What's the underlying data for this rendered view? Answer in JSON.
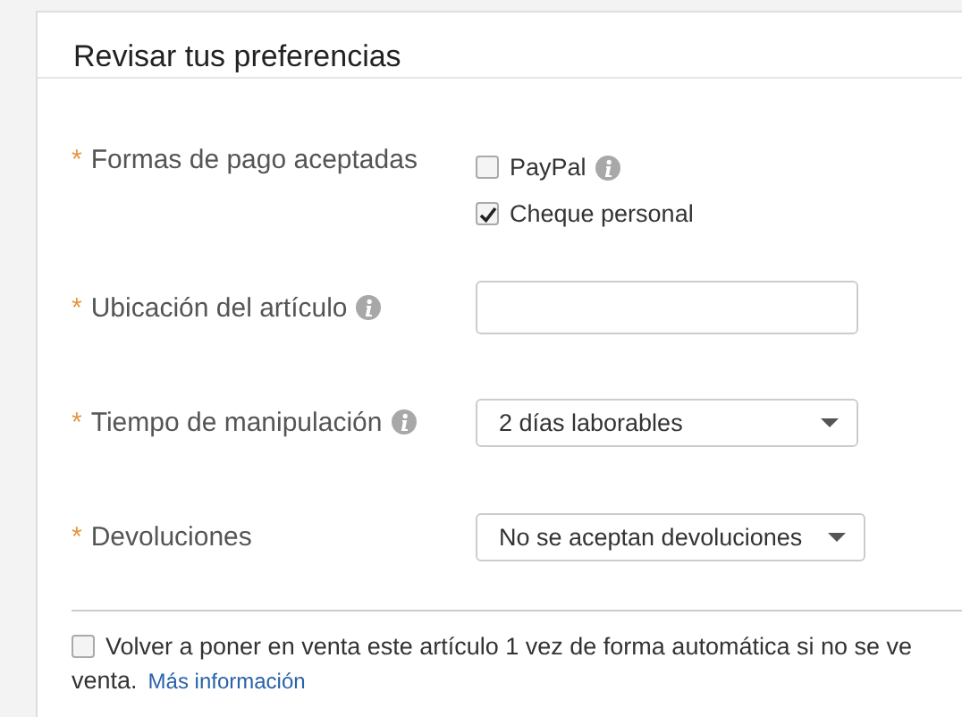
{
  "card": {
    "title": "Revisar tus preferencias"
  },
  "fields": [
    {
      "kind": "checkboxes",
      "marker": "*",
      "label": "Formas de pago aceptadas",
      "info": false,
      "options": [
        {
          "label": "PayPal",
          "checked": false,
          "info": true
        },
        {
          "label": "Cheque personal",
          "checked": true,
          "info": false
        }
      ]
    },
    {
      "kind": "text",
      "marker": "*",
      "label": "Ubicación del artículo",
      "info": true
    },
    {
      "kind": "select",
      "marker": "*",
      "label": "Tiempo de manipulación",
      "info": true,
      "value": "2 días laborables"
    },
    {
      "kind": "select",
      "marker": "*",
      "label": "Devoluciones",
      "info": false,
      "value": "No se aceptan devoluciones"
    }
  ],
  "relist": {
    "checked": false,
    "line_1": "Volver a poner en venta este artículo 1 vez de forma automática si no se ve",
    "line_2": "venta.",
    "link": "Más información"
  }
}
